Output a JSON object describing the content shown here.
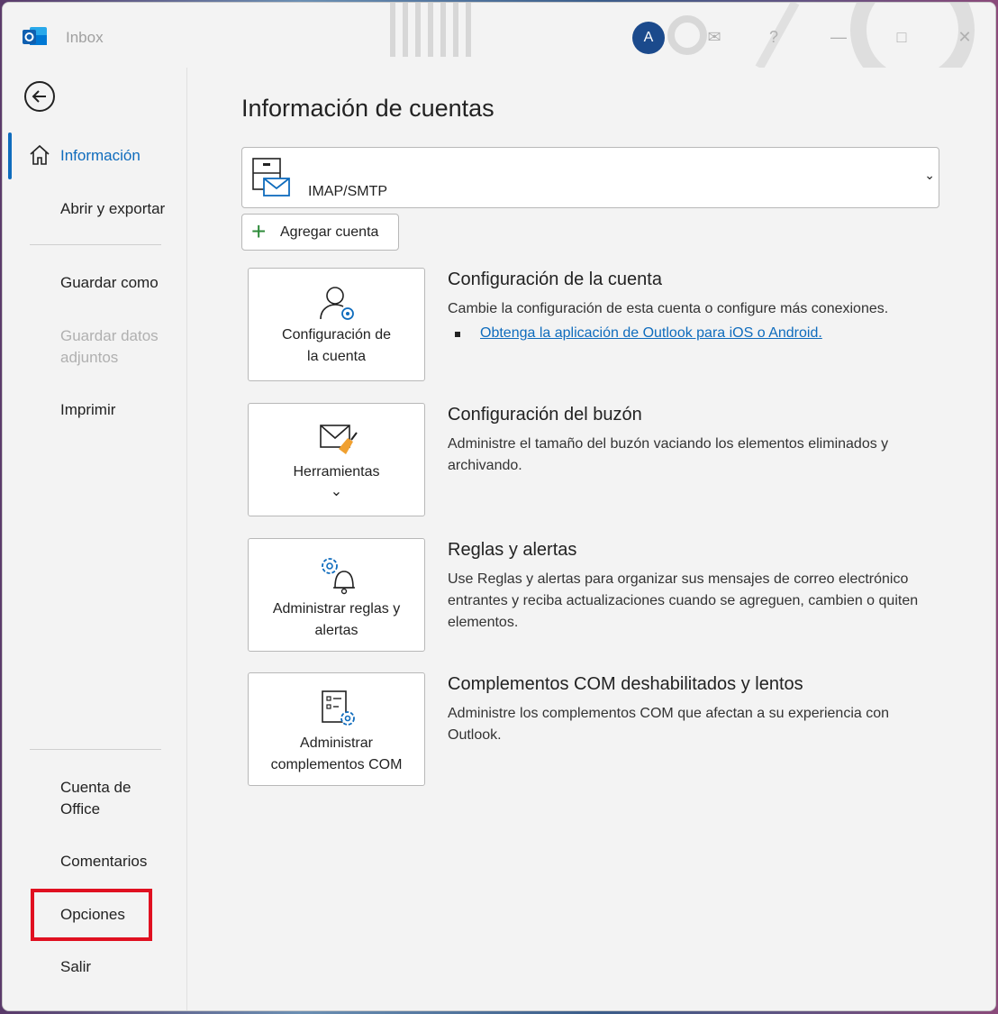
{
  "titlebar": {
    "app_title": "Inbox",
    "avatar_initial": "A",
    "icons": [
      "outlook-icon",
      "feedback-icon",
      "help-icon",
      "minimize-icon",
      "maximize-icon",
      "close-icon"
    ]
  },
  "sidebar": {
    "items": [
      {
        "label": "Información",
        "state": "active"
      },
      {
        "label": "Abrir y exportar",
        "state": "normal"
      },
      {
        "label": "Guardar como",
        "state": "normal"
      },
      {
        "label": "Guardar datos adjuntos",
        "state": "disabled"
      },
      {
        "label": "Imprimir",
        "state": "normal"
      },
      {
        "label": "Cuenta de Office",
        "state": "normal"
      },
      {
        "label": "Comentarios",
        "state": "normal"
      },
      {
        "label": "Opciones",
        "state": "highlighted"
      },
      {
        "label": "Salir",
        "state": "normal"
      }
    ]
  },
  "main": {
    "title": "Información de cuentas",
    "account": {
      "type": "IMAP/SMTP"
    },
    "add_account_label": "Agregar cuenta",
    "sections": [
      {
        "card_label": "Configuración de la cuenta",
        "title": "Configuración de la cuenta",
        "description": "Cambie la configuración de esta cuenta o configure más conexiones.",
        "link": "Obtenga la aplicación de Outlook para iOS o Android."
      },
      {
        "card_label": "Herramientas",
        "title": "Configuración del buzón",
        "description": "Administre el tamaño del buzón vaciando los elementos eliminados y archivando."
      },
      {
        "card_label": "Administrar reglas y alertas",
        "title": "Reglas y alertas",
        "description": "Use Reglas y alertas para organizar sus mensajes de correo electrónico entrantes y reciba actualizaciones cuando se agreguen, cambien o quiten elementos."
      },
      {
        "card_label": "Administrar complementos COM",
        "title": "Complementos COM deshabilitados y lentos",
        "description": "Administre los complementos COM que afectan a su experiencia con Outlook."
      }
    ]
  },
  "colors": {
    "accent": "#0f6cbd",
    "highlight": "#e01020",
    "add_plus": "#2e8b3a"
  }
}
